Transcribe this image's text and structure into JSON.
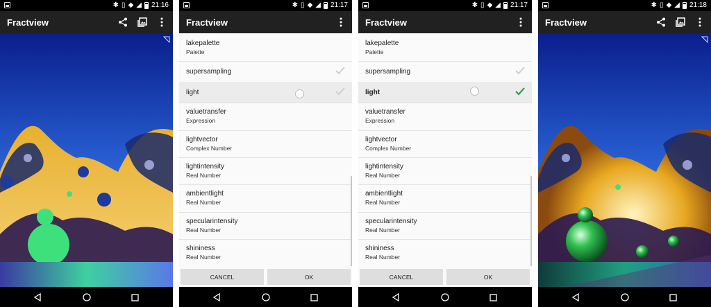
{
  "app_title": "Fractview",
  "screens": [
    {
      "time": "21:16"
    },
    {
      "time": "21:17"
    },
    {
      "time": "21:17"
    },
    {
      "time": "21:18"
    }
  ],
  "dialog": {
    "items": [
      {
        "label": "lakepalette",
        "sub": "Palette"
      },
      {
        "label": "supersampling",
        "sub": ""
      },
      {
        "label": "light",
        "sub": ""
      },
      {
        "label": "valuetransfer",
        "sub": "Expression"
      },
      {
        "label": "lightvector",
        "sub": "Complex Number"
      },
      {
        "label": "lightintensity",
        "sub": "Real Number"
      },
      {
        "label": "ambientlight",
        "sub": "Real Number"
      },
      {
        "label": "specularintensity",
        "sub": "Real Number"
      },
      {
        "label": "shininess",
        "sub": "Real Number"
      }
    ],
    "cancel_label": "CANCEL",
    "ok_label": "OK"
  },
  "colors": {
    "appbar": "#212121",
    "accent_check": "#2ea043",
    "dialog_bg": "#fafafa"
  },
  "icons": [
    "share-icon",
    "image-icon",
    "overflow-menu-icon",
    "bluetooth-icon",
    "vibrate-icon",
    "wifi-icon",
    "signal-icon",
    "battery-icon",
    "back-icon",
    "home-icon",
    "recent-apps-icon",
    "check-icon"
  ]
}
